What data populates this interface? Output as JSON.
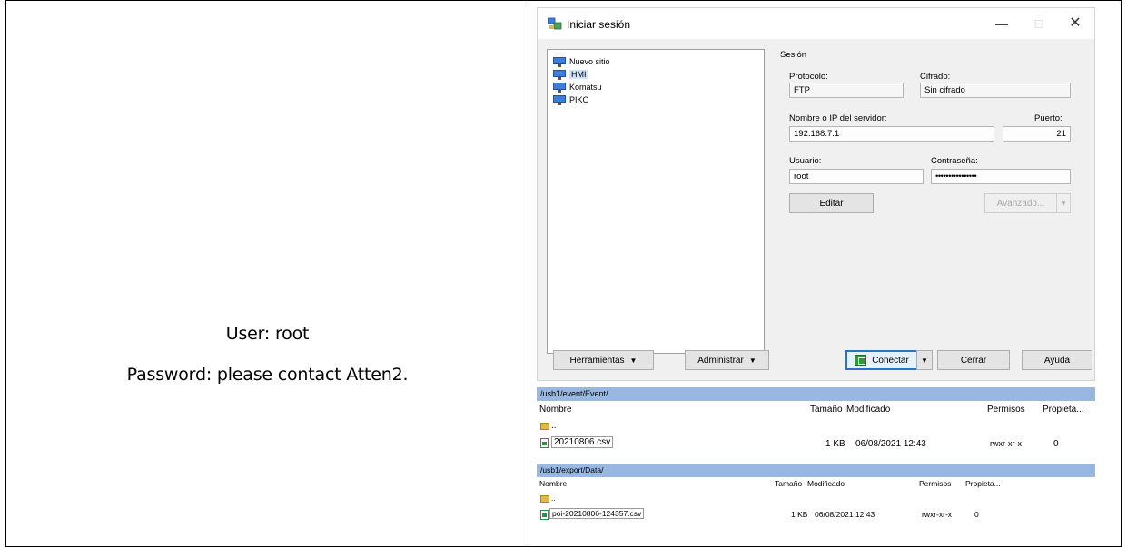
{
  "left_cell": {
    "user_line": "User: root",
    "password_line": "Password: please contact Atten2."
  },
  "dialog": {
    "title": "Iniciar sesión",
    "window_controls": {
      "minimize": "—",
      "maximize": "□",
      "close": "✕"
    },
    "sites": [
      {
        "label": "Nuevo sitio",
        "selected": false
      },
      {
        "label": "HMI",
        "selected": true
      },
      {
        "label": "Komatsu",
        "selected": false
      },
      {
        "label": "PIKO",
        "selected": false
      }
    ],
    "session": {
      "heading": "Sesión",
      "protocol_label": "Protocolo:",
      "protocol_value": "FTP",
      "encryption_label": "Cifrado:",
      "encryption_value": "Sin cifrado",
      "host_label": "Nombre o IP del servidor:",
      "host_value": "192.168.7.1",
      "port_label": "Puerto:",
      "port_value": "21",
      "user_label": "Usuario:",
      "user_value": "root",
      "password_label": "Contraseña:",
      "password_value": "••••••••••••••••",
      "edit_button": "Editar",
      "advanced_button": "Avanzado..."
    },
    "buttons": {
      "tools": "Herramientas",
      "manage": "Administrar",
      "connect": "Conectar",
      "close": "Cerrar",
      "help": "Ayuda"
    }
  },
  "panel1": {
    "path": "/usb1/event/Event/",
    "columns": [
      "Nombre",
      "Tamaño",
      "Modificado",
      "Permisos",
      "Propieta..."
    ],
    "parent_dir": "..",
    "file": {
      "name": "20210806.csv",
      "size": "1 KB",
      "modified": "06/08/2021 12:43",
      "permissions": "rwxr-xr-x",
      "owner": "0"
    }
  },
  "panel2": {
    "path": "/usb1/export/Data/",
    "columns": [
      "Nombre",
      "Tamaño",
      "Modificado",
      "Permisos",
      "Propieta..."
    ],
    "parent_dir": "..",
    "file": {
      "name": "poi-20210806-124357.csv",
      "size": "1 KB",
      "modified": "06/08/2021 12:43",
      "permissions": "rwxr-xr-x",
      "owner": "0"
    }
  }
}
